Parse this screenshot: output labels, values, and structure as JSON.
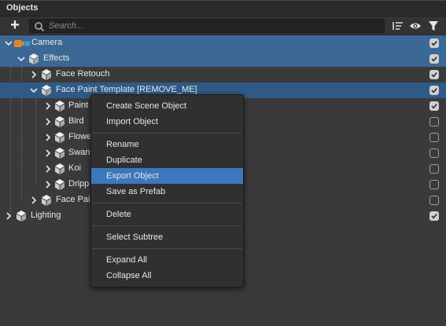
{
  "panel": {
    "title": "Objects"
  },
  "toolbar": {
    "add_label": "+",
    "search_placeholder": "Search...",
    "icons": [
      "plus-icon",
      "search-icon",
      "sort-list-icon",
      "eye-icon",
      "filter-icon"
    ]
  },
  "tree": {
    "rows": [
      {
        "label": "Camera",
        "checked": true
      },
      {
        "label": "Effects",
        "checked": true
      },
      {
        "label": "Face Retouch",
        "checked": true
      },
      {
        "label": "Face Paint Template [REMOVE_ME]",
        "checked": true
      },
      {
        "label": "Paint",
        "checked": true
      },
      {
        "label": "Bird",
        "checked": false
      },
      {
        "label": "Flowe",
        "checked": false
      },
      {
        "label": "Swan",
        "checked": false
      },
      {
        "label": "Koi",
        "checked": false
      },
      {
        "label": "Dripp",
        "checked": false
      },
      {
        "label": "Face Pai",
        "checked": false
      },
      {
        "label": "Lighting",
        "checked": true
      }
    ]
  },
  "context_menu": {
    "items": [
      "Create Scene Object",
      "Import Object",
      "Rename",
      "Duplicate",
      "Export Object",
      "Save as Prefab",
      "Delete",
      "Select Subtree",
      "Expand All",
      "Collapse All"
    ],
    "highlighted": "Export Object"
  },
  "colors": {
    "selection": "#3b6894",
    "menu_highlight": "#3b78bd",
    "camera_orange": "#e0872a",
    "camera_blue": "#3a9be0"
  }
}
